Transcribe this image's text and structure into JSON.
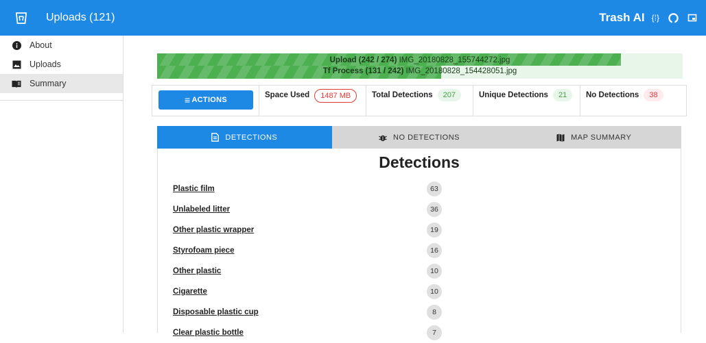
{
  "appbar": {
    "title": "Uploads (121)",
    "brand": "Trash AI",
    "icons": [
      "trash-icon",
      "json-icon",
      "github-icon",
      "export-icon"
    ],
    "json_glyph": "{⁞}"
  },
  "sidebar": {
    "items": [
      {
        "label": "About",
        "icon": "info-icon"
      },
      {
        "label": "Uploads",
        "icon": "image-icon"
      },
      {
        "label": "Summary",
        "icon": "book-icon"
      }
    ]
  },
  "progress": {
    "upload_label": "Upload (242 / 274)",
    "upload_file": "IMG_20180828_155744272.jpg",
    "upload_fraction": 0.883,
    "process_label": "Tf Process (131 / 242)",
    "process_file": "IMG_20180828_154428051.jpg",
    "process_fraction": 0.541
  },
  "stats": {
    "actions_label": "ACTIONS",
    "space_used_label": "Space Used",
    "space_used_value": "1487 MB",
    "total_detections_label": "Total Detections",
    "total_detections_value": "207",
    "unique_detections_label": "Unique Detections",
    "unique_detections_value": "21",
    "no_detections_label": "No Detections",
    "no_detections_value": "38"
  },
  "tabs": [
    {
      "label": "DETECTIONS",
      "icon": "document-icon",
      "active": true
    },
    {
      "label": "NO DETECTIONS",
      "icon": "bug-icon",
      "active": false
    },
    {
      "label": "MAP SUMMARY",
      "icon": "map-icon",
      "active": false
    }
  ],
  "panel": {
    "title": "Detections",
    "rows": [
      {
        "name": "Plastic film",
        "count": "63"
      },
      {
        "name": "Unlabeled litter",
        "count": "36"
      },
      {
        "name": "Other plastic wrapper",
        "count": "19"
      },
      {
        "name": "Styrofoam piece",
        "count": "16"
      },
      {
        "name": "Other plastic",
        "count": "10"
      },
      {
        "name": "Cigarette",
        "count": "10"
      },
      {
        "name": "Disposable plastic cup",
        "count": "8"
      },
      {
        "name": "Clear plastic bottle",
        "count": "7"
      }
    ]
  },
  "colors": {
    "primary": "#1e88e5",
    "progress_green": "#4caf50",
    "danger": "#e53935",
    "success": "#43a047"
  }
}
